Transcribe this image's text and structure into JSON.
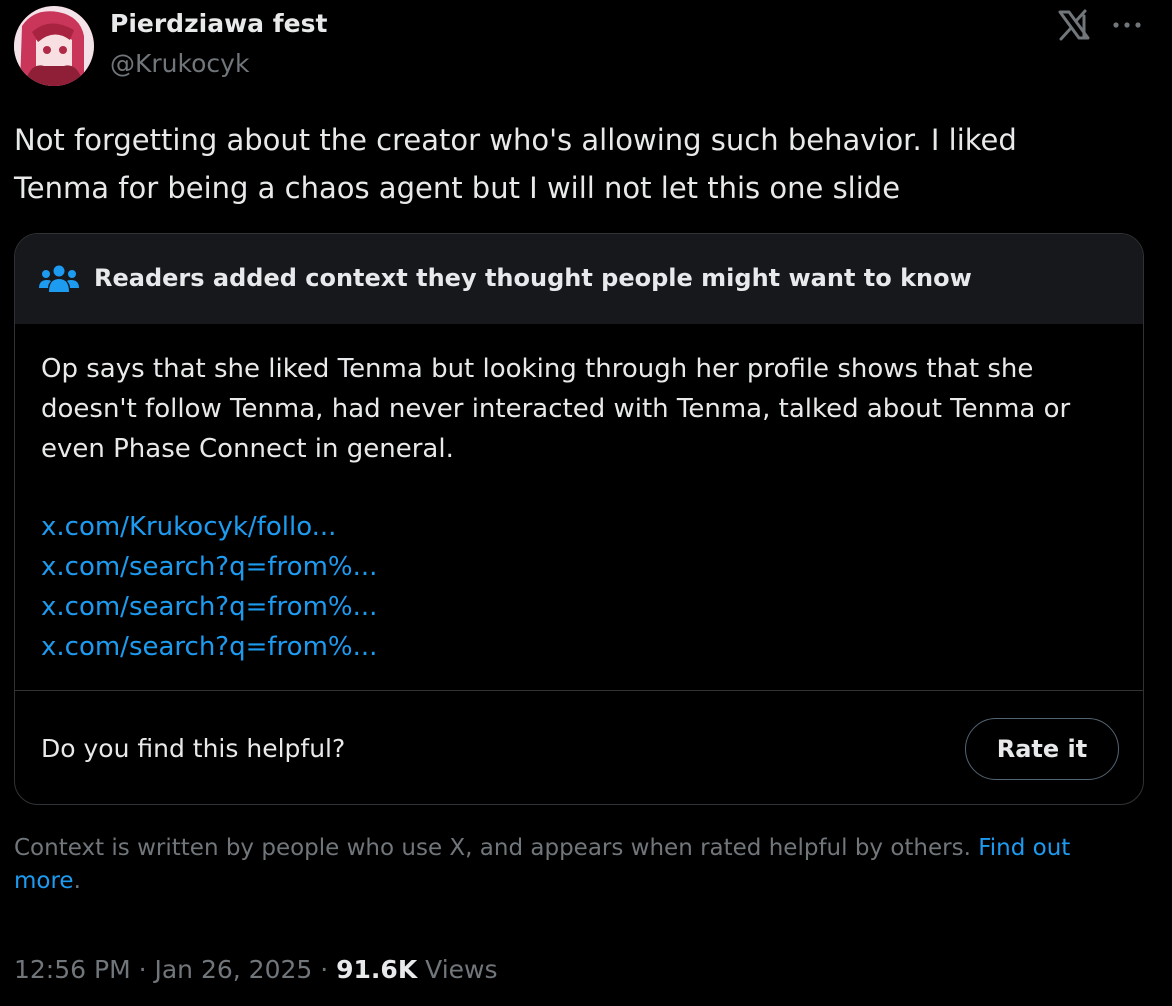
{
  "author": {
    "name": "Pierdziawa fest",
    "handle": "@Krukocyk"
  },
  "header_icons": [
    "x-logo-icon",
    "more-icon"
  ],
  "tweet": {
    "text": "Not forgetting about the creator who's allowing such behavior. I liked\nTenma for being a chaos agent but I will not let this one slide"
  },
  "community_note": {
    "icon": "people-icon",
    "title": "Readers added context they thought people might want to know",
    "body": "Op says that she liked Tenma but looking through her profile shows that she doesn't follow Tenma, had never interacted with Tenma, talked about Tenma or even Phase Connect in general.",
    "links": [
      "x.com/Krukocyk/follo...",
      "x.com/search?q=from%...",
      "x.com/search?q=from%...",
      "x.com/search?q=from%..."
    ],
    "helpful_question": "Do you find this helpful?",
    "rate_button": "Rate it"
  },
  "disclaimer": {
    "text": "Context is written by people who use X, and appears when rated helpful by others.",
    "link_text": "Find out more",
    "trailing": "."
  },
  "meta": {
    "time": "12:56 PM",
    "separator": " · ",
    "date": "Jan 26, 2025",
    "views_count": "91.6K",
    "views_label": "Views"
  },
  "colors": {
    "background": "#000000",
    "text": "#e7e9ea",
    "secondary_text": "#71767b",
    "link": "#1d9bf0",
    "note_header_bg": "#16181c",
    "border": "#2f3336"
  }
}
